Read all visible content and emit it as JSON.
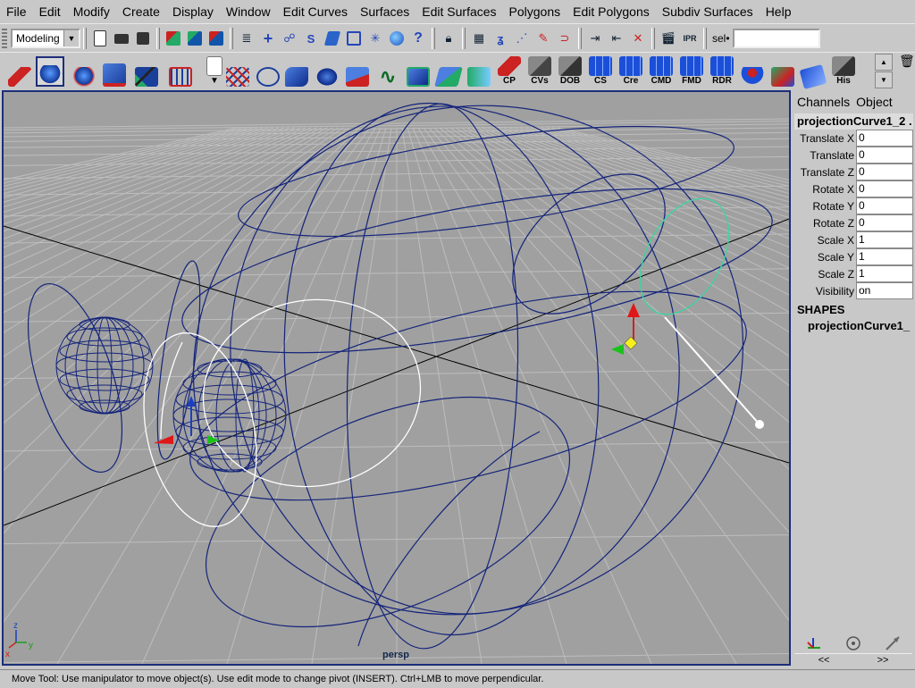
{
  "menu": [
    "File",
    "Edit",
    "Modify",
    "Create",
    "Display",
    "Window",
    "Edit Curves",
    "Surfaces",
    "Edit Surfaces",
    "Polygons",
    "Edit Polygons",
    "Subdiv Surfaces",
    "Help"
  ],
  "status_line": {
    "mode": "Modeling",
    "sel_label": "sel•",
    "sel_value": ""
  },
  "shelf": {
    "labels": [
      "CP",
      "CVs",
      "DOB",
      "CS",
      "Cre",
      "CMD",
      "FMD",
      "RDR",
      "His"
    ]
  },
  "viewport": {
    "camera": "persp",
    "axis_x": "x",
    "axis_y": "y",
    "axis_z": "z"
  },
  "channels": {
    "tabs": [
      "Channels",
      "Object"
    ],
    "object_name": "projectionCurve1_2 .",
    "attributes": [
      {
        "label": "Translate X",
        "value": "0"
      },
      {
        "label": "Translate",
        "value": "0"
      },
      {
        "label": "Translate Z",
        "value": "0"
      },
      {
        "label": "Rotate X",
        "value": "0"
      },
      {
        "label": "Rotate Y",
        "value": "0"
      },
      {
        "label": "Rotate Z",
        "value": "0"
      },
      {
        "label": "Scale X",
        "value": "1"
      },
      {
        "label": "Scale Y",
        "value": "1"
      },
      {
        "label": "Scale Z",
        "value": "1"
      },
      {
        "label": "Visibility",
        "value": "on"
      }
    ],
    "shapes_header": "SHAPES",
    "shape_name": "projectionCurve1_",
    "pager_left": "<<",
    "pager_right": ">>"
  },
  "help_line": "Move Tool: Use manipulator to move object(s). Use edit mode to change pivot (INSERT).  Ctrl+LMB to move perpendicular.",
  "colors": {
    "wire": "#14247a",
    "selected_curve": "#ffffff",
    "active_curve": "#3ad6a0",
    "grid": "#bdbdbd",
    "viewport_bg": "#a0a0a0"
  }
}
